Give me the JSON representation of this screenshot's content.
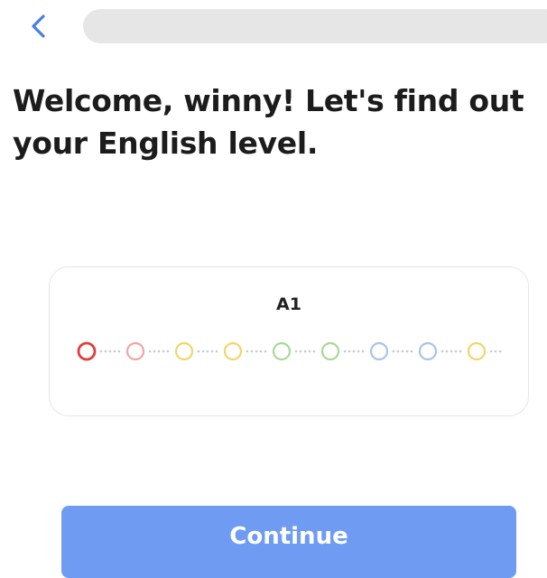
{
  "header": {
    "back_icon": "chevron-left-icon",
    "progress": 0.0
  },
  "main": {
    "heading": "Welcome, winny! Let's find out your English level."
  },
  "level_card": {
    "current_level": "A1",
    "steps": [
      {
        "color": "#e23b3b",
        "active": true
      },
      {
        "color": "#f1a5a5",
        "active": false
      },
      {
        "color": "#f2d568",
        "active": false
      },
      {
        "color": "#f2d568",
        "active": false
      },
      {
        "color": "#a9d79a",
        "active": false
      },
      {
        "color": "#a9d79a",
        "active": false
      },
      {
        "color": "#a8c3ee",
        "active": false
      },
      {
        "color": "#a8c3ee",
        "active": false
      },
      {
        "color": "#f2d568",
        "active": false
      }
    ]
  },
  "footer": {
    "continue_label": "Continue"
  },
  "colors": {
    "accent": "#6f9cf2",
    "back_icon": "#4a7fe0",
    "dot_connector": "#c9c9c9"
  }
}
